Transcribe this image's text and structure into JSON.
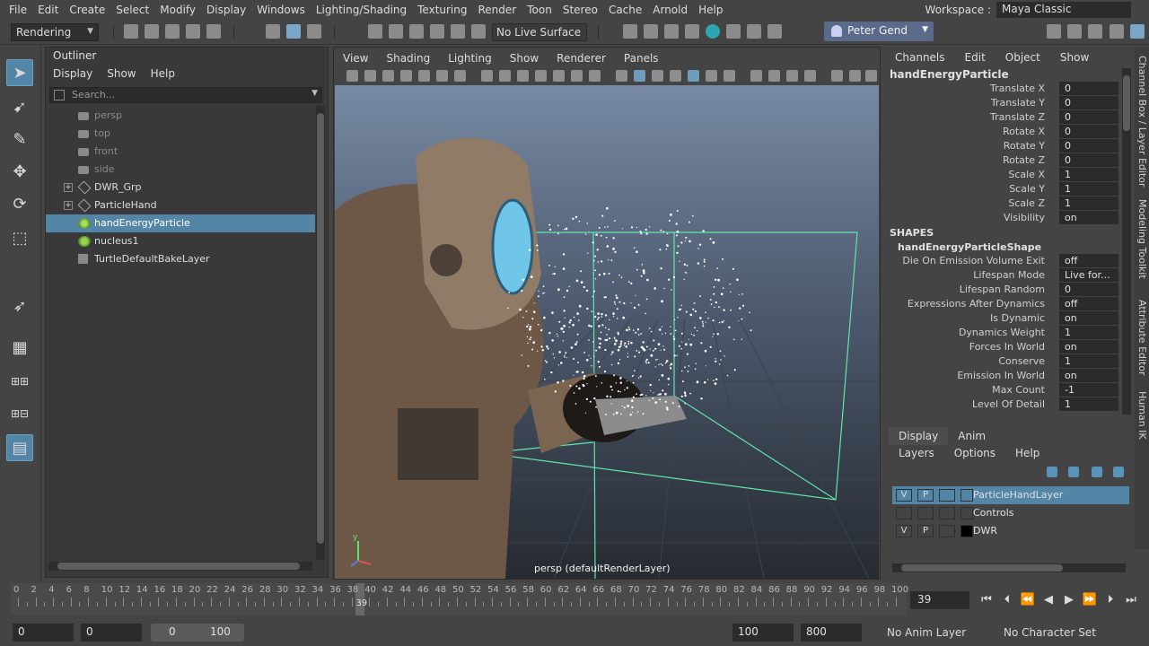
{
  "menubar": {
    "items": [
      "File",
      "Edit",
      "Create",
      "Select",
      "Modify",
      "Display",
      "Windows",
      "Lighting/Shading",
      "Texturing",
      "Render",
      "Toon",
      "Stereo",
      "Cache",
      "Arnold",
      "Help"
    ],
    "workspace_label": "Workspace :",
    "workspace_value": "Maya Classic"
  },
  "statusline": {
    "mode": "Rendering",
    "live_surface": "No Live Surface",
    "user": "Peter Gend"
  },
  "outliner": {
    "title": "Outliner",
    "menu": [
      "Display",
      "Show",
      "Help"
    ],
    "search_placeholder": "Search...",
    "items": [
      {
        "label": "persp",
        "icon": "camera-icon",
        "dim": true,
        "expandable": false
      },
      {
        "label": "top",
        "icon": "camera-icon",
        "dim": true,
        "expandable": false
      },
      {
        "label": "front",
        "icon": "camera-icon",
        "dim": true,
        "expandable": false
      },
      {
        "label": "side",
        "icon": "camera-icon",
        "dim": true,
        "expandable": false
      },
      {
        "label": "DWR_Grp",
        "icon": "group-icon",
        "dim": false,
        "expandable": true
      },
      {
        "label": "ParticleHand",
        "icon": "group-icon",
        "dim": false,
        "expandable": true
      },
      {
        "label": "handEnergyParticle",
        "icon": "particle-icon",
        "dim": false,
        "expandable": false,
        "selected": true
      },
      {
        "label": "nucleus1",
        "icon": "nucleus-icon",
        "dim": false,
        "expandable": false
      },
      {
        "label": "TurtleDefaultBakeLayer",
        "icon": "node-icon",
        "dim": false,
        "expandable": false
      }
    ]
  },
  "viewport": {
    "menu": [
      "View",
      "Shading",
      "Lighting",
      "Show",
      "Renderer",
      "Panels"
    ],
    "label": "persp (defaultRenderLayer)",
    "axis_y": "y"
  },
  "channelbox": {
    "menu": [
      "Channels",
      "Edit",
      "Object",
      "Show"
    ],
    "node": "handEnergyParticle",
    "transform": [
      {
        "name": "Translate X",
        "value": "0"
      },
      {
        "name": "Translate Y",
        "value": "0"
      },
      {
        "name": "Translate Z",
        "value": "0"
      },
      {
        "name": "Rotate X",
        "value": "0"
      },
      {
        "name": "Rotate Y",
        "value": "0"
      },
      {
        "name": "Rotate Z",
        "value": "0"
      },
      {
        "name": "Scale X",
        "value": "1"
      },
      {
        "name": "Scale Y",
        "value": "1"
      },
      {
        "name": "Scale Z",
        "value": "1"
      },
      {
        "name": "Visibility",
        "value": "on"
      }
    ],
    "shapes_header": "SHAPES",
    "shape_node": "handEnergyParticleShape",
    "shape_attrs": [
      {
        "name": "Die On Emission Volume Exit",
        "value": "off"
      },
      {
        "name": "Lifespan Mode",
        "value": "Live for..."
      },
      {
        "name": "Lifespan Random",
        "value": "0"
      },
      {
        "name": "Expressions After Dynamics",
        "value": "off"
      },
      {
        "name": "Is Dynamic",
        "value": "on"
      },
      {
        "name": "Dynamics Weight",
        "value": "1"
      },
      {
        "name": "Forces In World",
        "value": "on"
      },
      {
        "name": "Conserve",
        "value": "1"
      },
      {
        "name": "Emission In World",
        "value": "on"
      },
      {
        "name": "Max Count",
        "value": "-1"
      },
      {
        "name": "Level Of Detail",
        "value": "1"
      }
    ]
  },
  "sidetabs": [
    "Channel Box / Layer Editor",
    "Modeling Toolkit",
    "Attribute Editor",
    "Human IK"
  ],
  "layers": {
    "tabs": [
      "Display",
      "Anim"
    ],
    "menu": [
      "Layers",
      "Options",
      "Help"
    ],
    "rows": [
      {
        "v": "V",
        "p": "P",
        "name": "ParticleHandLayer",
        "selected": true
      },
      {
        "v": "",
        "p": "",
        "name": "Controls",
        "selected": false
      },
      {
        "v": "V",
        "p": "P",
        "name": "DWR",
        "selected": false
      }
    ]
  },
  "timeline": {
    "start": 0,
    "end": 100,
    "current_frame": "39",
    "playhead_label": "39"
  },
  "range": {
    "anim_start": "0",
    "playback_start": "0",
    "slider_start": "0",
    "slider_end": "100",
    "playback_end": "100",
    "anim_end": "800",
    "anim_layer": "No Anim Layer",
    "character_set": "No Character Set"
  }
}
